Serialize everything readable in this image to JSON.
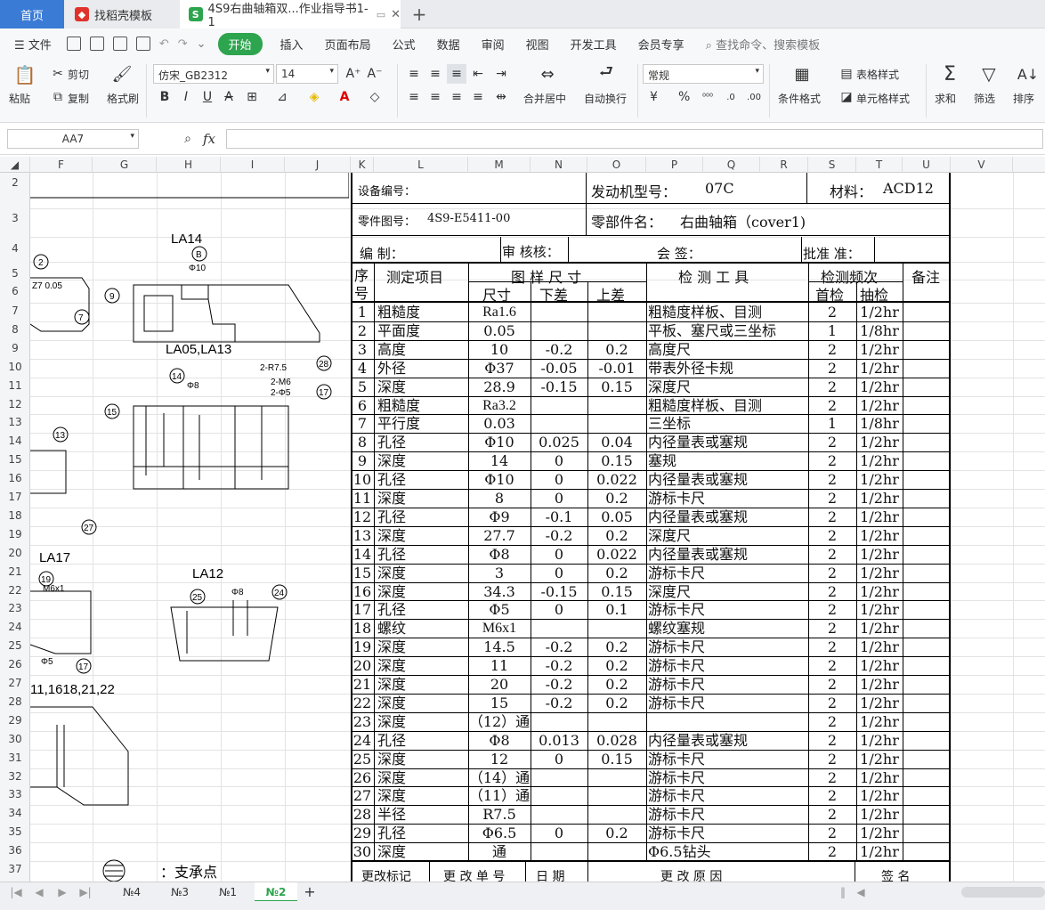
{
  "tabs": {
    "home": "首页",
    "template": "找稻壳模板",
    "doc": "4S9右曲轴箱双...作业指导书1-1"
  },
  "menu": {
    "file": "文件",
    "items": [
      "开始",
      "插入",
      "页面布局",
      "公式",
      "数据",
      "审阅",
      "视图",
      "开发工具",
      "会员专享"
    ],
    "search": "查找命令、搜索模板"
  },
  "ribbon": {
    "paste": "粘贴",
    "cut": "剪切",
    "copy": "复制",
    "format_painter": "格式刷",
    "font": "仿宋_GB2312",
    "size": "14",
    "merge": "合并居中",
    "wrap": "自动换行",
    "numfmt": "常规",
    "cond_format": "条件格式",
    "table_style": "表格样式",
    "cell_style": "单元格样式",
    "sum": "求和",
    "filter": "筛选",
    "sort": "排序",
    "currency": "¥",
    "percent": "%"
  },
  "formula": {
    "cell_ref": "AA7",
    "fx": "fx"
  },
  "columns": [
    "F",
    "G",
    "H",
    "I",
    "J",
    "K",
    "L",
    "M",
    "N",
    "O",
    "P",
    "Q",
    "R",
    "S",
    "T",
    "U",
    "V"
  ],
  "rows": [
    "2",
    "3",
    "4",
    "5",
    "6",
    "7",
    "8",
    "9",
    "10",
    "11",
    "12",
    "13",
    "14",
    "15",
    "16",
    "17",
    "18",
    "19",
    "20",
    "21",
    "22",
    "23",
    "24",
    "25",
    "26",
    "27",
    "28",
    "29",
    "30",
    "31",
    "32",
    "33",
    "34",
    "35",
    "36",
    "37"
  ],
  "header": {
    "equip_no": "设备编号：",
    "engine_label": "发动机型号：",
    "engine_value": "07C",
    "material_label": "材料：",
    "material_value": "ACD12",
    "part_no_label": "零件图号：",
    "part_no_value": "4S9-E5411-00",
    "part_name_label": "零部件名：",
    "part_name_value": "右曲轴箱（cover1)",
    "compile": "编 制：",
    "review": "审 核核：",
    "sign": "会 签：",
    "approve": "批准 准：",
    "col_seq1": "序",
    "col_seq2": "号",
    "col_item": "测定项目",
    "col_spec": "图 样 尺 寸",
    "col_size": "尺寸",
    "col_lower": "下差",
    "col_upper": "上差",
    "col_tool": "检 测 工 具",
    "col_freq": "检测频次",
    "col_first": "首检",
    "col_sample": "抽检",
    "col_note": "备注"
  },
  "table_rows": [
    {
      "no": "1",
      "item": "粗糙度",
      "size": "Ra1.6",
      "lower": "",
      "upper": "",
      "tool": "粗糙度样板、目测",
      "first": "2",
      "sample": "1/2hr"
    },
    {
      "no": "2",
      "item": "平面度",
      "size": "0.05",
      "lower": "",
      "upper": "",
      "tool": "平板、塞尺或三坐标",
      "first": "1",
      "sample": "1/8hr"
    },
    {
      "no": "3",
      "item": "高度",
      "size": "10",
      "lower": "-0.2",
      "upper": "0.2",
      "tool": "高度尺",
      "first": "2",
      "sample": "1/2hr"
    },
    {
      "no": "4",
      "item": "外径",
      "size": "Φ37",
      "lower": "-0.05",
      "upper": "-0.01",
      "tool": "带表外径卡规",
      "first": "2",
      "sample": "1/2hr"
    },
    {
      "no": "5",
      "item": "深度",
      "size": "28.9",
      "lower": "-0.15",
      "upper": "0.15",
      "tool": "深度尺",
      "first": "2",
      "sample": "1/2hr"
    },
    {
      "no": "6",
      "item": "粗糙度",
      "size": "Ra3.2",
      "lower": "",
      "upper": "",
      "tool": "粗糙度样板、目测",
      "first": "2",
      "sample": "1/2hr"
    },
    {
      "no": "7",
      "item": "平行度",
      "size": "0.03",
      "lower": "",
      "upper": "",
      "tool": "三坐标",
      "first": "1",
      "sample": "1/8hr"
    },
    {
      "no": "8",
      "item": "孔径",
      "size": "Φ10",
      "lower": "0.025",
      "upper": "0.04",
      "tool": "内径量表或塞规",
      "first": "2",
      "sample": "1/2hr"
    },
    {
      "no": "9",
      "item": "深度",
      "size": "14",
      "lower": "0",
      "upper": "0.15",
      "tool": "塞规",
      "first": "2",
      "sample": "1/2hr"
    },
    {
      "no": "10",
      "item": "孔径",
      "size": "Φ10",
      "lower": "0",
      "upper": "0.022",
      "tool": "内径量表或塞规",
      "first": "2",
      "sample": "1/2hr"
    },
    {
      "no": "11",
      "item": "深度",
      "size": "8",
      "lower": "0",
      "upper": "0.2",
      "tool": "游标卡尺",
      "first": "2",
      "sample": "1/2hr"
    },
    {
      "no": "12",
      "item": "孔径",
      "size": "Φ9",
      "lower": "-0.1",
      "upper": "0.05",
      "tool": "内径量表或塞规",
      "first": "2",
      "sample": "1/2hr"
    },
    {
      "no": "13",
      "item": "深度",
      "size": "27.7",
      "lower": "-0.2",
      "upper": "0.2",
      "tool": "深度尺",
      "first": "2",
      "sample": "1/2hr"
    },
    {
      "no": "14",
      "item": "孔径",
      "size": "Φ8",
      "lower": "0",
      "upper": "0.022",
      "tool": "内径量表或塞规",
      "first": "2",
      "sample": "1/2hr"
    },
    {
      "no": "15",
      "item": "深度",
      "size": "3",
      "lower": "0",
      "upper": "0.2",
      "tool": "游标卡尺",
      "first": "2",
      "sample": "1/2hr"
    },
    {
      "no": "16",
      "item": "深度",
      "size": "34.3",
      "lower": "-0.15",
      "upper": "0.15",
      "tool": "深度尺",
      "first": "2",
      "sample": "1/2hr"
    },
    {
      "no": "17",
      "item": "孔径",
      "size": "Φ5",
      "lower": "0",
      "upper": "0.1",
      "tool": "游标卡尺",
      "first": "2",
      "sample": "1/2hr"
    },
    {
      "no": "18",
      "item": "螺纹",
      "size": "M6x1",
      "lower": "",
      "upper": "",
      "tool": "螺纹塞规",
      "first": "2",
      "sample": "1/2hr"
    },
    {
      "no": "19",
      "item": "深度",
      "size": "14.5",
      "lower": "-0.2",
      "upper": "0.2",
      "tool": "游标卡尺",
      "first": "2",
      "sample": "1/2hr"
    },
    {
      "no": "20",
      "item": "深度",
      "size": "11",
      "lower": "-0.2",
      "upper": "0.2",
      "tool": "游标卡尺",
      "first": "2",
      "sample": "1/2hr"
    },
    {
      "no": "21",
      "item": "深度",
      "size": "20",
      "lower": "-0.2",
      "upper": "0.2",
      "tool": "游标卡尺",
      "first": "2",
      "sample": "1/2hr"
    },
    {
      "no": "22",
      "item": "深度",
      "size": "15",
      "lower": "-0.2",
      "upper": "0.2",
      "tool": "游标卡尺",
      "first": "2",
      "sample": "1/2hr"
    },
    {
      "no": "23",
      "item": "深度",
      "size": "（12）通",
      "lower": "",
      "upper": "",
      "tool": "",
      "first": "2",
      "sample": "1/2hr"
    },
    {
      "no": "24",
      "item": "孔径",
      "size": "Φ8",
      "lower": "0.013",
      "upper": "0.028",
      "tool": "内径量表或塞规",
      "first": "2",
      "sample": "1/2hr"
    },
    {
      "no": "25",
      "item": "深度",
      "size": "12",
      "lower": "0",
      "upper": "0.15",
      "tool": "游标卡尺",
      "first": "2",
      "sample": "1/2hr"
    },
    {
      "no": "26",
      "item": "深度",
      "size": "（14）通",
      "lower": "",
      "upper": "",
      "tool": "游标卡尺",
      "first": "2",
      "sample": "1/2hr"
    },
    {
      "no": "27",
      "item": "深度",
      "size": "（11）通",
      "lower": "",
      "upper": "",
      "tool": "游标卡尺",
      "first": "2",
      "sample": "1/2hr"
    },
    {
      "no": "28",
      "item": "半径",
      "size": "R7.5",
      "lower": "",
      "upper": "",
      "tool": "游标卡尺",
      "first": "2",
      "sample": "1/2hr"
    },
    {
      "no": "29",
      "item": "孔径",
      "size": "Φ6.5",
      "lower": "0",
      "upper": "0.2",
      "tool": "游标卡尺",
      "first": "2",
      "sample": "1/2hr"
    },
    {
      "no": "30",
      "item": "深度",
      "size": "通",
      "lower": "",
      "upper": "",
      "tool": "Φ6.5钻头",
      "first": "2",
      "sample": "1/2hr"
    }
  ],
  "footer": {
    "change_mark": "更改标记",
    "change_no": "更 改 单 号",
    "date": "日 期",
    "reason": "更 改 原 因",
    "signature": "签 名"
  },
  "drawing": {
    "la14": "LA14",
    "la05": "LA05,LA13",
    "la17": "LA17",
    "la12": "LA12",
    "la11": "11,1618,21,22",
    "support": "：支承点"
  },
  "sheet_tabs": [
    "№4",
    "№3",
    "№1",
    "№2"
  ],
  "active_sheet": "№2",
  "colors": {
    "home_tab": "#3a7bd5",
    "start_btn": "#2da44e",
    "active_sheet": "#2da44e"
  }
}
